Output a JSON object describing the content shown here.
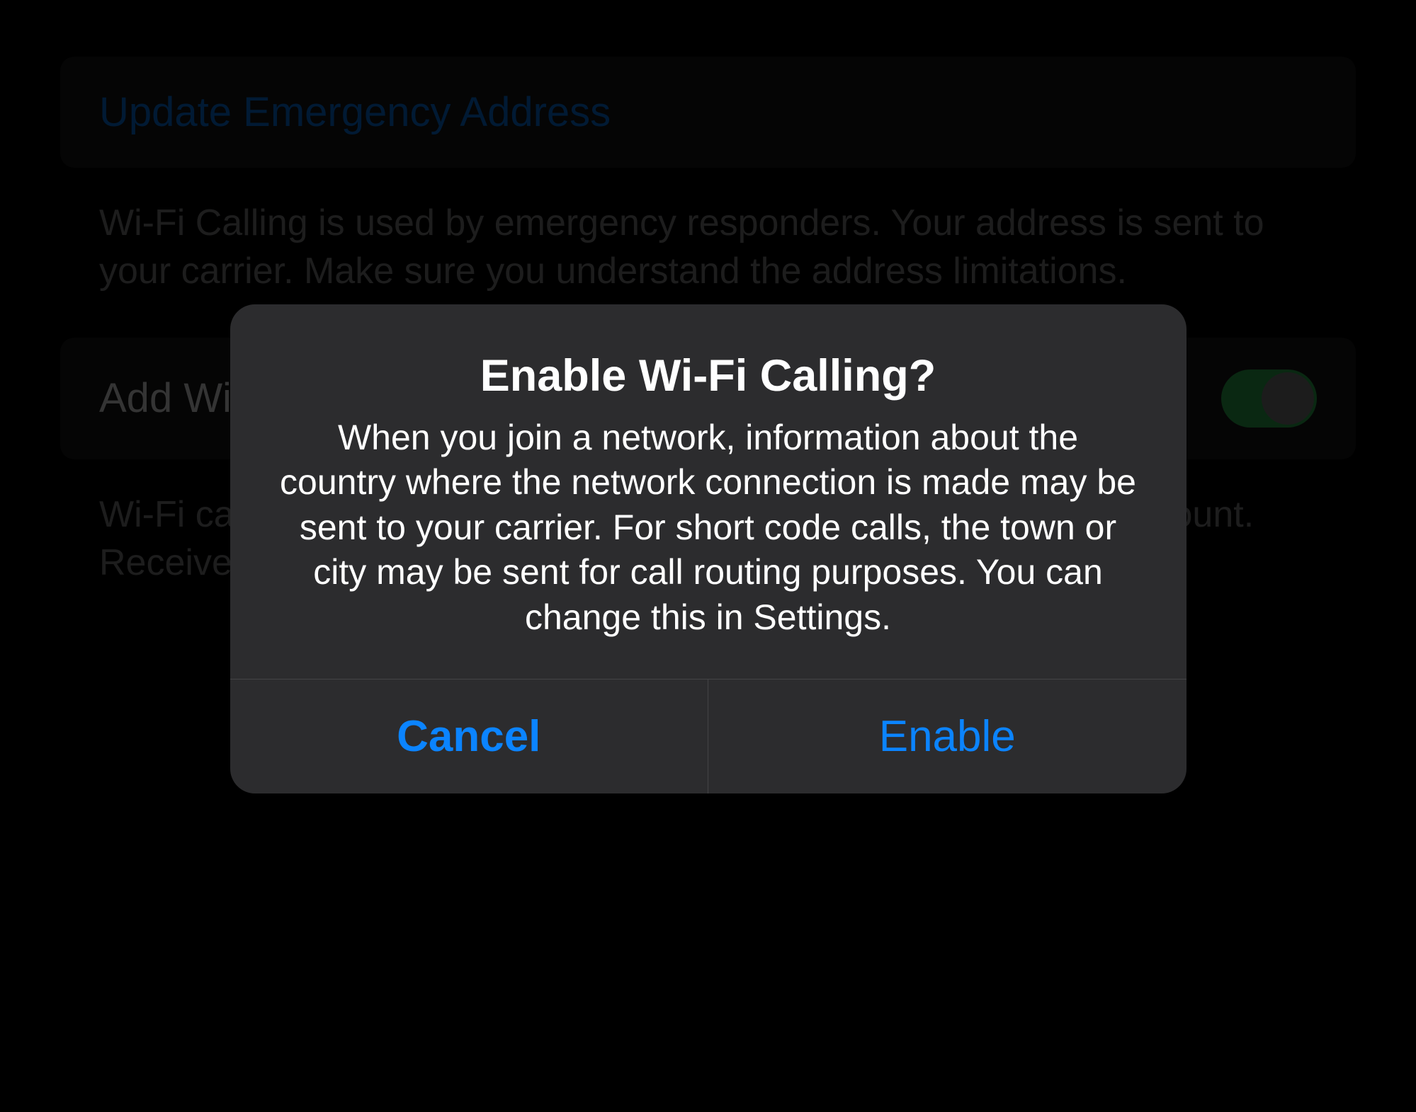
{
  "background": {
    "update_link": "Update Emergency Address",
    "description_top": "Wi-Fi Calling is used by emergency responders. Your address is sent to your carrier. Make sure you understand the address limitations.",
    "toggle_label": "Add Wi-Fi Calling For Other Devices",
    "toggle_on": true,
    "description_bottom": "Wi-Fi calling extends to other devices signed in to your iCloud account. Receive calls even when your iPhone is not nearby."
  },
  "modal": {
    "title": "Enable Wi-Fi Calling?",
    "body": "When you join a network, information about the country where the network connection is made may be sent to your carrier. For short code calls, the town or city may be sent for call routing purposes. You can change this in Settings.",
    "cancel": "Cancel",
    "enable": "Enable"
  }
}
